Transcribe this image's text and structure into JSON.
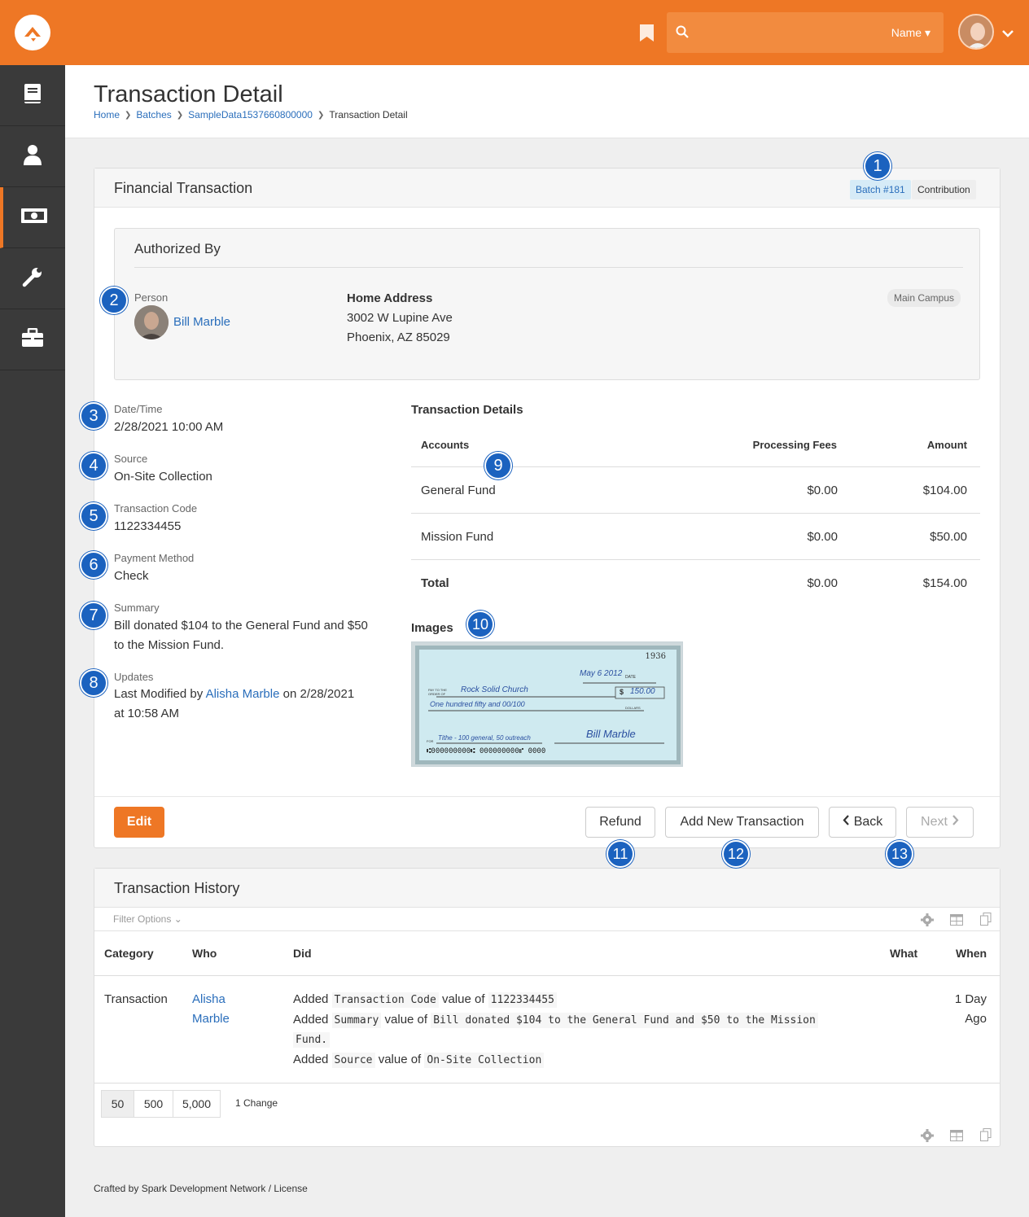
{
  "header": {
    "search_filter": "Name"
  },
  "page": {
    "title": "Transaction Detail",
    "breadcrumbs": [
      "Home",
      "Batches",
      "SampleData1537660800000",
      "Transaction Detail"
    ]
  },
  "transaction_panel": {
    "title": "Financial Transaction",
    "batch_label": "Batch #181",
    "type_label": "Contribution",
    "authorized_by": {
      "heading": "Authorized By",
      "person_label": "Person",
      "person_name": "Bill Marble",
      "address_label": "Home Address",
      "address_line1": "3002 W Lupine Ave",
      "address_line2": "Phoenix, AZ 85029",
      "campus": "Main Campus"
    },
    "fields": {
      "datetime_label": "Date/Time",
      "datetime_value": "2/28/2021 10:00 AM",
      "source_label": "Source",
      "source_value": "On-Site Collection",
      "code_label": "Transaction Code",
      "code_value": "1122334455",
      "payment_label": "Payment Method",
      "payment_value": "Check",
      "summary_label": "Summary",
      "summary_line1": "Bill donated $104 to the General Fund and $50",
      "summary_line2": "to the Mission Fund.",
      "updates_label": "Updates",
      "updates_prefix": "Last Modified by",
      "updates_person": "Alisha Marble",
      "updates_suffix": "on 2/28/2021",
      "updates_line2": "at 10:58 AM"
    },
    "details": {
      "heading": "Transaction Details",
      "columns": [
        "Accounts",
        "Processing Fees",
        "Amount"
      ],
      "rows": [
        {
          "account": "General Fund",
          "fees": "$0.00",
          "amount": "$104.00"
        },
        {
          "account": "Mission Fund",
          "fees": "$0.00",
          "amount": "$50.00"
        }
      ],
      "total": {
        "label": "Total",
        "fees": "$0.00",
        "amount": "$154.00"
      }
    },
    "images_label": "Images",
    "check": {
      "number": "1936",
      "date": "May 6 2012",
      "payee": "Rock Solid Church",
      "amount": "150.00",
      "written": "One hundred fifty and 00/100",
      "memo": "Tithe - 100 general, 50 outreach",
      "signature": "Bill Marble",
      "micr": "⑆000000000⑆  000000000⑈  0000",
      "pay_label": "PAY TO THE ORDER OF",
      "dollars_label": "DOLLARS",
      "for_label": "FOR",
      "date_label": "DATE",
      "currency_symbol": "$"
    },
    "buttons": {
      "edit": "Edit",
      "refund": "Refund",
      "add_new": "Add New Transaction",
      "back": "Back",
      "next": "Next"
    }
  },
  "history_panel": {
    "title": "Transaction History",
    "filter_options": "Filter Options",
    "columns": [
      "Category",
      "Who",
      "Did",
      "What",
      "When"
    ],
    "row": {
      "category": "Transaction",
      "who_line1": "Alisha",
      "who_line2": "Marble",
      "when_line1": "1 Day",
      "when_line2": "Ago",
      "added": "Added",
      "value_of": "value of",
      "field1": "Transaction Code",
      "value1": "1122334455",
      "field2": "Summary",
      "value2a": "Bill donated $104 to the General Fund and $50 to the Mission",
      "value2b": "Fund.",
      "field3": "Source",
      "value3": "On-Site Collection"
    },
    "page_sizes": [
      "50",
      "500",
      "5,000"
    ],
    "change_count": "1 Change"
  },
  "annotations": [
    "1",
    "2",
    "3",
    "4",
    "5",
    "6",
    "7",
    "8",
    "9",
    "10",
    "11",
    "12",
    "13"
  ],
  "footer": "Crafted by Spark Development Network / License",
  "colors": {
    "brand": "#ee7725",
    "sidebar": "#3a3a3a",
    "link": "#2a6ebb",
    "annotation": "#1b62bf"
  }
}
